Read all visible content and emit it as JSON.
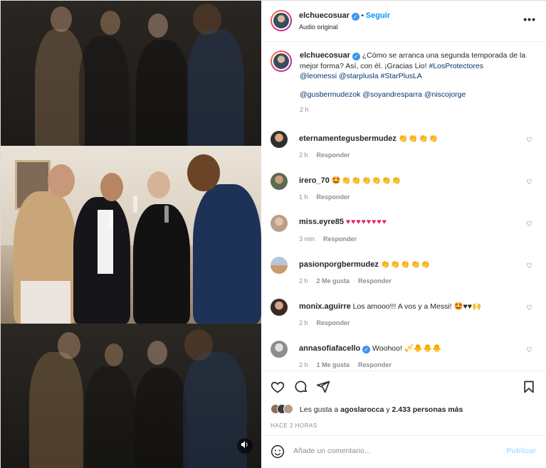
{
  "post": {
    "username": "elchuecosuar",
    "follow_label": "Seguir",
    "audio_label": "Audio original",
    "more_label": "•••",
    "caption": {
      "username": "elchuecosuar",
      "text": "¿Cómo se arranca una segunda temporada de la mejor forma? Así, con él. ¡Gracias Lio!",
      "hashtag1": "#LosProtectores",
      "mentions_line": "@leomessi @starplusla #StarPlusLA",
      "mentions2": "@gusbermudezok @soyandresparra @niscojorge",
      "time": "2 h"
    }
  },
  "comments": [
    {
      "username": "eternamentegusbermudez",
      "text": "👏👏👏👏",
      "time": "2 h",
      "likes": "",
      "reply": "Responder"
    },
    {
      "username": "irero_70",
      "text": "🤩👏👏👏👏👏👏",
      "time": "1 h",
      "likes": "",
      "reply": "Responder"
    },
    {
      "username": "miss.eyre85",
      "text": "♥♥♥♥♥♥♥♥",
      "time": "3 min",
      "likes": "",
      "reply": "Responder"
    },
    {
      "username": "pasionporgbermudez",
      "text": "👏👏👏👏👏",
      "time": "2 h",
      "likes": "2 Me gusta",
      "reply": "Responder"
    },
    {
      "username": "monix.aguirre",
      "text": "Los amooo!!! A vos y a Messi! 🤩♥♥🙌",
      "time": "2 h",
      "likes": "",
      "reply": "Responder"
    },
    {
      "username": "annasofiafacello",
      "text": "Woohoo! 🎺🐥🐥🐥",
      "time": "2 h",
      "likes": "1 Me gusta",
      "reply": "Responder"
    }
  ],
  "likes": {
    "prefix": "Les gusta a",
    "user": "agoslarocca",
    "connector": "y",
    "count": "2.433 personas más"
  },
  "posted_ago": "HACE 2 HORAS",
  "add_comment": {
    "placeholder": "Añade un comentario...",
    "publish": "Publicar"
  },
  "colors": {
    "link": "#00376b",
    "follow": "#0095f6",
    "verified": "#3897f0",
    "muted": "#8e8e8e"
  },
  "icons": [
    "heart-icon",
    "comment-icon",
    "share-icon",
    "bookmark-icon",
    "smile-icon",
    "volume-icon",
    "verified-icon",
    "more-icon"
  ]
}
